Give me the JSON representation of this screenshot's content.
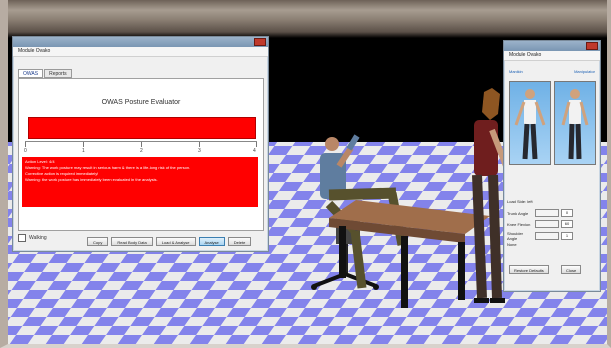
{
  "left_window": {
    "menu": "Module  Ovako",
    "tabs": [
      "OWAS",
      "Reports"
    ],
    "title": "OWAS Posture Evaluator",
    "scale": [
      "0",
      "1",
      "2",
      "3",
      "4"
    ],
    "result_lines": [
      "Action Level: 4/4",
      "Warning: The work posture may result in serious harm & there is a life-long risk of the person.",
      "",
      "Corrective action is required immediately!",
      "Warning: the work posture has immediately been evaluated in the analysis."
    ],
    "checkbox_label": "Walking",
    "buttons": [
      "Copy",
      "Read Body Data",
      "Load & Analyse",
      "Analyse",
      "Delete"
    ]
  },
  "right_window": {
    "menu": "Module  Ovako",
    "label_left": "Manikin",
    "label_right": "Manipulator",
    "side_label": "Load Side: left",
    "fields": [
      {
        "label": "Trunk Angle",
        "value": "0"
      },
      {
        "label": "Knee Flexion",
        "value": "60"
      },
      {
        "label": "Shoulder Angle",
        "value": "1"
      }
    ],
    "note": "None",
    "buttons": [
      "Restore Defaults",
      "Close"
    ]
  },
  "colors": {
    "floor_a": "#8f8fff",
    "floor_b": "#ffffff",
    "alert_red": "#ff0000"
  }
}
